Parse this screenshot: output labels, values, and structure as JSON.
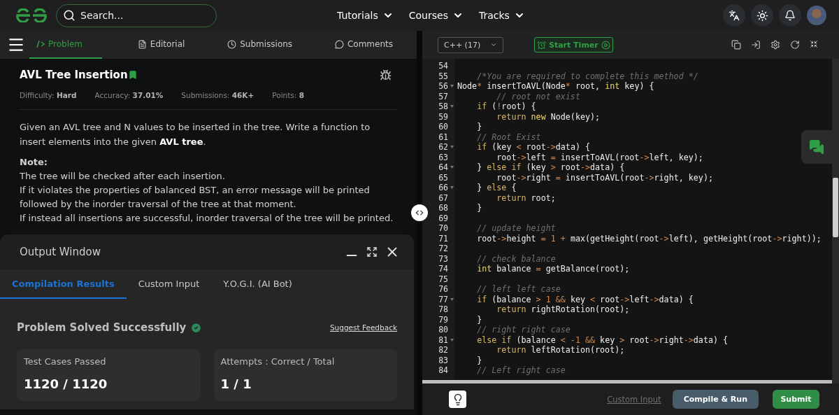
{
  "nav": {
    "search": {
      "placeholder": "Search..."
    },
    "menus": [
      {
        "label": "Tutorials"
      },
      {
        "label": "Courses"
      },
      {
        "label": "Tracks"
      }
    ]
  },
  "problem_tabs": [
    {
      "label": "Problem",
      "selected": true
    },
    {
      "label": "Editorial",
      "selected": false
    },
    {
      "label": "Submissions",
      "selected": false
    },
    {
      "label": "Comments",
      "selected": false
    }
  ],
  "problem": {
    "title": "AVL Tree Insertion",
    "bookmarked": true,
    "stats": [
      "Difficulty: **Hard**",
      "Accuracy: **37.01%**",
      "Submissions: **46K+**",
      "Points: **8**"
    ],
    "description": "Given an AVL tree and N values to be inserted in the tree. Write a function to insert elements into the given **AVL tree**.",
    "note_heading": "Note:",
    "note_lines": [
      "The tree will be checked after each insertion.",
      "If it violates the properties of balanced BST, an error message will be printed followed by the inorder traversal of the tree at that moment.",
      "If instead all insertions are successful, inorder traversal of the tree will be printed."
    ]
  },
  "output_window": {
    "title": "Output Window",
    "tabs": [
      {
        "label": "Compilation Results",
        "selected": true
      },
      {
        "label": "Custom Input",
        "selected": false
      },
      {
        "label": "Y.O.G.I. (AI Bot)",
        "selected": false
      }
    ],
    "status": "Problem Solved Successfully",
    "feedback_link": "Suggest Feedback",
    "cards": [
      {
        "label": "Test Cases Passed",
        "value": "1120 / 1120"
      },
      {
        "label": "Attempts : Correct / Total",
        "value": "1 / 1"
      }
    ]
  },
  "editor": {
    "language": "C++ (17)",
    "timer_button": "Start Timer",
    "lines": [
      {
        "number": "54",
        "fold": false
      },
      {
        "number": "55",
        "fold": false,
        "tokens": [
          {
            "kind": "comment",
            "text": "    /*You are required to complete this method */"
          }
        ]
      },
      {
        "number": "56",
        "fold": true,
        "tokens": [
          {
            "kind": "plain",
            "text": "Node"
          },
          {
            "kind": "op",
            "text": "*"
          },
          {
            "kind": "plain",
            "text": " insertToAVL(Node"
          },
          {
            "kind": "op",
            "text": "*"
          },
          {
            "kind": "plain",
            "text": " root, "
          },
          {
            "kind": "type",
            "text": "int"
          },
          {
            "kind": "plain",
            "text": " key) {"
          }
        ]
      },
      {
        "number": "57",
        "fold": false,
        "tokens": [
          {
            "kind": "comment",
            "text": "        // root not exist"
          }
        ]
      },
      {
        "number": "58",
        "fold": true,
        "tokens": [
          {
            "kind": "keyword",
            "text": "    if"
          },
          {
            "kind": "plain",
            "text": " ("
          },
          {
            "kind": "op",
            "text": "!"
          },
          {
            "kind": "plain",
            "text": "root) {"
          }
        ]
      },
      {
        "number": "59",
        "fold": false,
        "tokens": [
          {
            "kind": "keyword",
            "text": "        return"
          },
          {
            "kind": "type",
            "text": " new"
          },
          {
            "kind": "plain",
            "text": " Node(key);"
          }
        ]
      },
      {
        "number": "60",
        "fold": false,
        "tokens": [
          {
            "kind": "plain",
            "text": "    }"
          }
        ]
      },
      {
        "number": "61",
        "fold": false,
        "tokens": [
          {
            "kind": "comment",
            "text": "    // Root Exist"
          }
        ]
      },
      {
        "number": "62",
        "fold": true,
        "tokens": [
          {
            "kind": "keyword",
            "text": "    if"
          },
          {
            "kind": "plain",
            "text": " (key "
          },
          {
            "kind": "op",
            "text": "<"
          },
          {
            "kind": "plain",
            "text": " root"
          },
          {
            "kind": "op",
            "text": "->"
          },
          {
            "kind": "plain",
            "text": "data) {"
          }
        ]
      },
      {
        "number": "63",
        "fold": false,
        "tokens": [
          {
            "kind": "plain",
            "text": "        root"
          },
          {
            "kind": "op",
            "text": "->"
          },
          {
            "kind": "plain",
            "text": "left "
          },
          {
            "kind": "op",
            "text": "="
          },
          {
            "kind": "plain",
            "text": " insertToAVL(root"
          },
          {
            "kind": "op",
            "text": "->"
          },
          {
            "kind": "plain",
            "text": "left, key);"
          }
        ]
      },
      {
        "number": "64",
        "fold": true,
        "tokens": [
          {
            "kind": "plain",
            "text": "    } "
          },
          {
            "kind": "keyword",
            "text": "else if"
          },
          {
            "kind": "plain",
            "text": " (key "
          },
          {
            "kind": "op",
            "text": ">"
          },
          {
            "kind": "plain",
            "text": " root"
          },
          {
            "kind": "op",
            "text": "->"
          },
          {
            "kind": "plain",
            "text": "data) {"
          }
        ]
      },
      {
        "number": "65",
        "fold": false,
        "tokens": [
          {
            "kind": "plain",
            "text": "        root"
          },
          {
            "kind": "op",
            "text": "->"
          },
          {
            "kind": "plain",
            "text": "right "
          },
          {
            "kind": "op",
            "text": "="
          },
          {
            "kind": "plain",
            "text": " insertToAVL(root"
          },
          {
            "kind": "op",
            "text": "->"
          },
          {
            "kind": "plain",
            "text": "right, key);"
          }
        ]
      },
      {
        "number": "66",
        "fold": true,
        "tokens": [
          {
            "kind": "plain",
            "text": "    } "
          },
          {
            "kind": "keyword",
            "text": "else"
          },
          {
            "kind": "plain",
            "text": " {"
          }
        ]
      },
      {
        "number": "67",
        "fold": false,
        "tokens": [
          {
            "kind": "keyword",
            "text": "        return"
          },
          {
            "kind": "plain",
            "text": " root;"
          }
        ]
      },
      {
        "number": "68",
        "fold": false,
        "tokens": [
          {
            "kind": "plain",
            "text": "    }"
          }
        ]
      },
      {
        "number": "69",
        "fold": false
      },
      {
        "number": "70",
        "fold": false,
        "tokens": [
          {
            "kind": "comment",
            "text": "    // update height"
          }
        ]
      },
      {
        "number": "71",
        "fold": false,
        "tokens": [
          {
            "kind": "plain",
            "text": "    root"
          },
          {
            "kind": "op",
            "text": "->"
          },
          {
            "kind": "plain",
            "text": "height "
          },
          {
            "kind": "op",
            "text": "= "
          },
          {
            "kind": "number",
            "text": "1 "
          },
          {
            "kind": "op",
            "text": "+"
          },
          {
            "kind": "plain",
            "text": " max(getHeight(root"
          },
          {
            "kind": "op",
            "text": "->"
          },
          {
            "kind": "plain",
            "text": "left), getHeight(root"
          },
          {
            "kind": "op",
            "text": "->"
          },
          {
            "kind": "plain",
            "text": "right));"
          }
        ]
      },
      {
        "number": "72",
        "fold": false
      },
      {
        "number": "73",
        "fold": false,
        "tokens": [
          {
            "kind": "comment",
            "text": "    // check balance"
          }
        ]
      },
      {
        "number": "74",
        "fold": false,
        "tokens": [
          {
            "kind": "type",
            "text": "    int"
          },
          {
            "kind": "plain",
            "text": " balance "
          },
          {
            "kind": "op",
            "text": "="
          },
          {
            "kind": "plain",
            "text": " getBalance(root);"
          }
        ]
      },
      {
        "number": "75",
        "fold": false
      },
      {
        "number": "76",
        "fold": false,
        "tokens": [
          {
            "kind": "comment",
            "text": "    // left left case"
          }
        ]
      },
      {
        "number": "77",
        "fold": true,
        "tokens": [
          {
            "kind": "keyword",
            "text": "    if"
          },
          {
            "kind": "plain",
            "text": " (balance "
          },
          {
            "kind": "op",
            "text": "> "
          },
          {
            "kind": "number",
            "text": "1 "
          },
          {
            "kind": "op",
            "text": "&&"
          },
          {
            "kind": "plain",
            "text": " key "
          },
          {
            "kind": "op",
            "text": "<"
          },
          {
            "kind": "plain",
            "text": " root"
          },
          {
            "kind": "op",
            "text": "->"
          },
          {
            "kind": "plain",
            "text": "left"
          },
          {
            "kind": "op",
            "text": "->"
          },
          {
            "kind": "plain",
            "text": "data) {"
          }
        ]
      },
      {
        "number": "78",
        "fold": false,
        "tokens": [
          {
            "kind": "keyword",
            "text": "        return"
          },
          {
            "kind": "plain",
            "text": " rightRotation(root);"
          }
        ]
      },
      {
        "number": "79",
        "fold": false,
        "tokens": [
          {
            "kind": "plain",
            "text": "    }"
          }
        ]
      },
      {
        "number": "80",
        "fold": false,
        "tokens": [
          {
            "kind": "comment",
            "text": "    // right right case"
          }
        ]
      },
      {
        "number": "81",
        "fold": true,
        "tokens": [
          {
            "kind": "keyword",
            "text": "    else if"
          },
          {
            "kind": "plain",
            "text": " (balance "
          },
          {
            "kind": "op",
            "text": "< "
          },
          {
            "kind": "number",
            "text": "-1 "
          },
          {
            "kind": "op",
            "text": "&&"
          },
          {
            "kind": "plain",
            "text": " key "
          },
          {
            "kind": "op",
            "text": ">"
          },
          {
            "kind": "plain",
            "text": " root"
          },
          {
            "kind": "op",
            "text": "->"
          },
          {
            "kind": "plain",
            "text": "right"
          },
          {
            "kind": "op",
            "text": "->"
          },
          {
            "kind": "plain",
            "text": "data) {"
          }
        ]
      },
      {
        "number": "82",
        "fold": false,
        "tokens": [
          {
            "kind": "keyword",
            "text": "        return"
          },
          {
            "kind": "plain",
            "text": " leftRotation(root);"
          }
        ]
      },
      {
        "number": "83",
        "fold": false,
        "tokens": [
          {
            "kind": "plain",
            "text": "    }"
          }
        ]
      },
      {
        "number": "84",
        "fold": false,
        "tokens": [
          {
            "kind": "comment",
            "text": "    // Left right case"
          }
        ]
      }
    ]
  },
  "footer": {
    "custom_input_link": "Custom Input",
    "compile_button": "Compile & Run",
    "submit_button": "Submit"
  }
}
